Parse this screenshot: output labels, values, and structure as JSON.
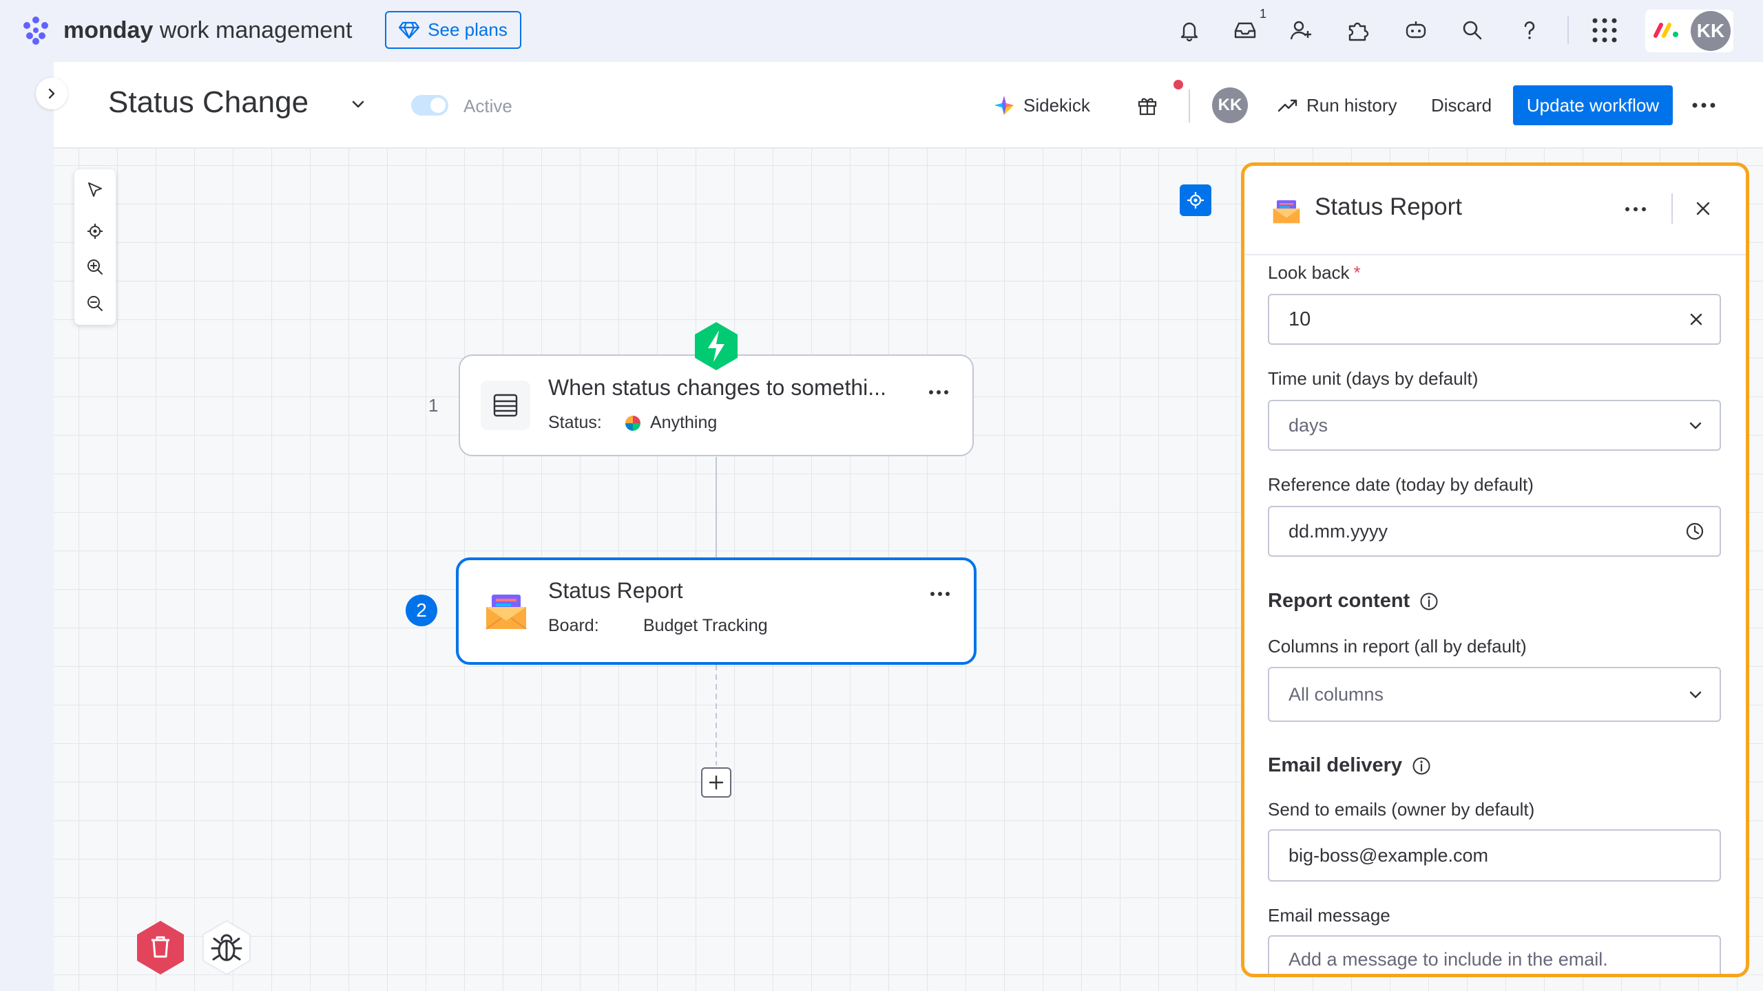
{
  "topbar": {
    "brand_bold": "monday",
    "brand_rest": " work management",
    "see_plans": "See plans",
    "inbox_count": "1",
    "avatar_initials": "KK"
  },
  "header": {
    "title": "Status Change",
    "active_label": "Active",
    "sidekick": "Sidekick",
    "avatar_initials": "KK",
    "run_history": "Run history",
    "discard": "Discard",
    "update": "Update workflow"
  },
  "nodes": [
    {
      "step": "1",
      "title": "When status changes to somethi...",
      "sub_label": "Status:",
      "sub_value": "Anything"
    },
    {
      "step": "2",
      "title": "Status Report",
      "sub_label": "Board:",
      "sub_value": "Budget Tracking"
    }
  ],
  "panel": {
    "title": "Status Report",
    "look_back_label": "Look back",
    "look_back_required": "*",
    "look_back_value": "10",
    "time_unit_label": "Time unit (days by default)",
    "time_unit_value": "days",
    "reference_date_label": "Reference date (today by default)",
    "reference_date_placeholder": "dd.mm.yyyy",
    "report_content_heading": "Report content",
    "columns_label": "Columns in report (all by default)",
    "columns_value": "All columns",
    "email_delivery_heading": "Email delivery",
    "send_to_label": "Send to emails (owner by default)",
    "send_to_value": "big-boss@example.com",
    "email_message_label": "Email message",
    "email_message_placeholder": "Add a message to include in the email."
  },
  "colors": {
    "accent": "#0073ea",
    "panel_border": "#f7a51e",
    "trigger_green": "#00ca72",
    "delete_red": "#e2445c"
  },
  "icons": [
    "monday-logo-icon",
    "diamond-icon",
    "bell-icon",
    "inbox-icon",
    "invite-icon",
    "apps-icon",
    "ai-icon",
    "search-icon",
    "help-icon",
    "grid-icon",
    "monday-apps-icon",
    "chevron-down-icon",
    "sidekick-icon",
    "gift-icon",
    "trend-icon",
    "more-icon",
    "pointer-icon",
    "locate-icon",
    "zoom-in-icon",
    "zoom-out-icon",
    "recenter-icon",
    "lightning-icon",
    "table-icon",
    "status-dot-icon",
    "mail-icon",
    "plus-icon",
    "trash-icon",
    "bug-icon",
    "close-icon",
    "clock-icon",
    "info-icon",
    "sidebar-expand-icon"
  ]
}
